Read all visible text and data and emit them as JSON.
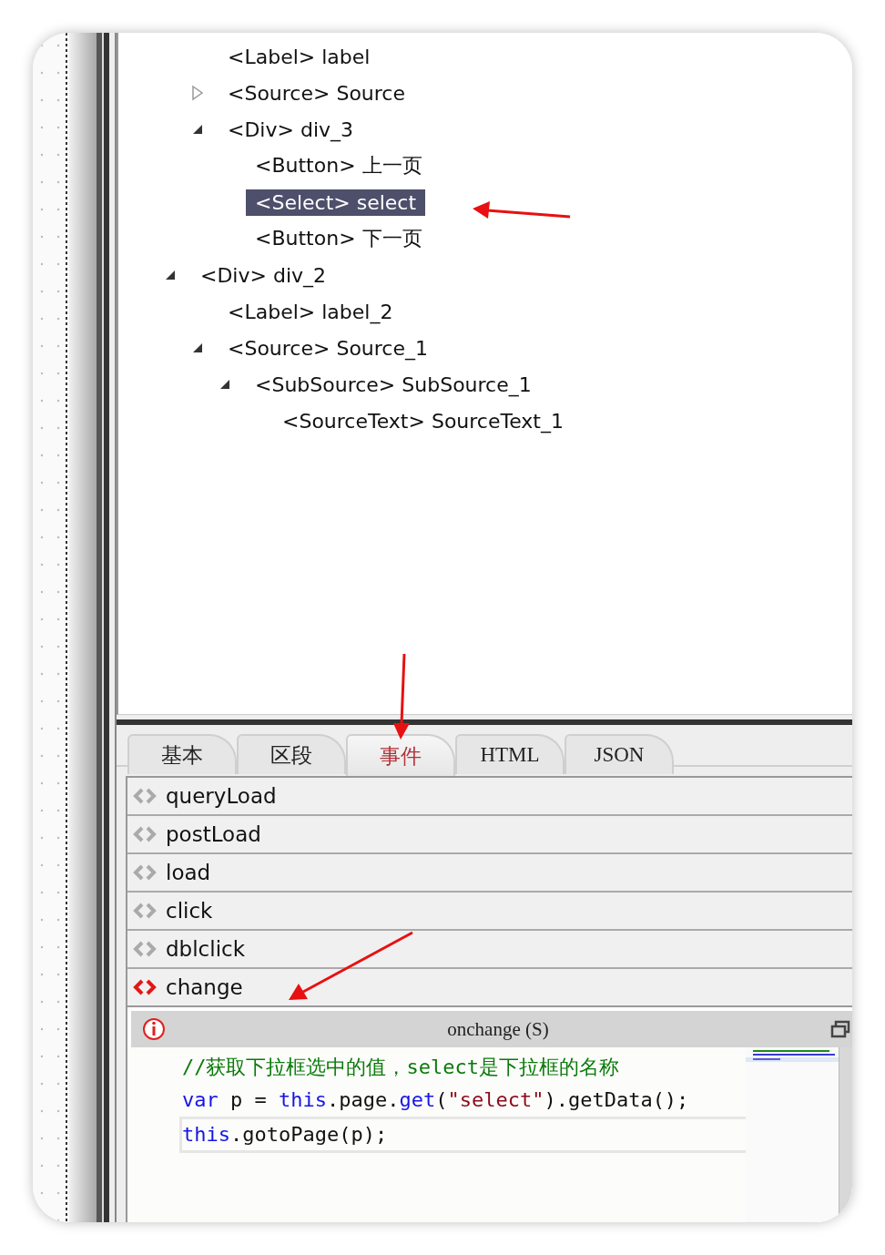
{
  "tree": {
    "clipped_branch": [
      {
        "tag": "<Label>",
        "name": "label",
        "selected": false
      },
      {
        "tag": "<Source>",
        "name": "Source",
        "expanded": false,
        "selected": false
      },
      {
        "tag": "<Div>",
        "name": "div_3",
        "expanded": true,
        "selected": false,
        "children": [
          {
            "tag": "<Button>",
            "name": "上一页",
            "selected": false
          },
          {
            "tag": "<Select>",
            "name": "select",
            "selected": true
          },
          {
            "tag": "<Button>",
            "name": "下一页",
            "selected": false
          }
        ]
      }
    ],
    "nodes": [
      {
        "tag": "<Div>",
        "name": "div_2",
        "expanded": true,
        "selected": false,
        "children": [
          {
            "tag": "<Label>",
            "name": "label_2",
            "selected": false
          },
          {
            "tag": "<Source>",
            "name": "Source_1",
            "expanded": true,
            "selected": false,
            "children": [
              {
                "tag": "<SubSource>",
                "name": "SubSource_1",
                "expanded": true,
                "selected": false,
                "children": [
                  {
                    "tag": "<SourceText>",
                    "name": "SourceText_1",
                    "selected": false
                  }
                ]
              }
            ]
          }
        ]
      }
    ]
  },
  "tabs": [
    {
      "label": "基本",
      "selected": false
    },
    {
      "label": "区段",
      "selected": false
    },
    {
      "label": "事件",
      "selected": true
    },
    {
      "label": "HTML",
      "selected": false
    },
    {
      "label": "JSON",
      "selected": false
    }
  ],
  "events": [
    {
      "name": "queryLoad",
      "active": false
    },
    {
      "name": "postLoad",
      "active": false
    },
    {
      "name": "load",
      "active": false
    },
    {
      "name": "click",
      "active": false
    },
    {
      "name": "dblclick",
      "active": false
    },
    {
      "name": "change",
      "active": true
    }
  ],
  "editor": {
    "title": "onchange (S)",
    "lines": [
      {
        "current": false,
        "tokens": [
          {
            "kind": "comment",
            "text": "//获取下拉框选中的值，select是下拉框的名称"
          }
        ]
      },
      {
        "current": false,
        "tokens": [
          {
            "kind": "keyword",
            "text": "var"
          },
          {
            "kind": "plain",
            "text": " p = "
          },
          {
            "kind": "keyword",
            "text": "this"
          },
          {
            "kind": "plain",
            "text": ".page."
          },
          {
            "kind": "keyword",
            "text": "get"
          },
          {
            "kind": "plain",
            "text": "("
          },
          {
            "kind": "string",
            "text": "\"select\""
          },
          {
            "kind": "plain",
            "text": ").getData();"
          }
        ]
      },
      {
        "current": true,
        "tokens": [
          {
            "kind": "keyword",
            "text": "this"
          },
          {
            "kind": "plain",
            "text": ".gotoPage(p);"
          }
        ]
      }
    ]
  }
}
